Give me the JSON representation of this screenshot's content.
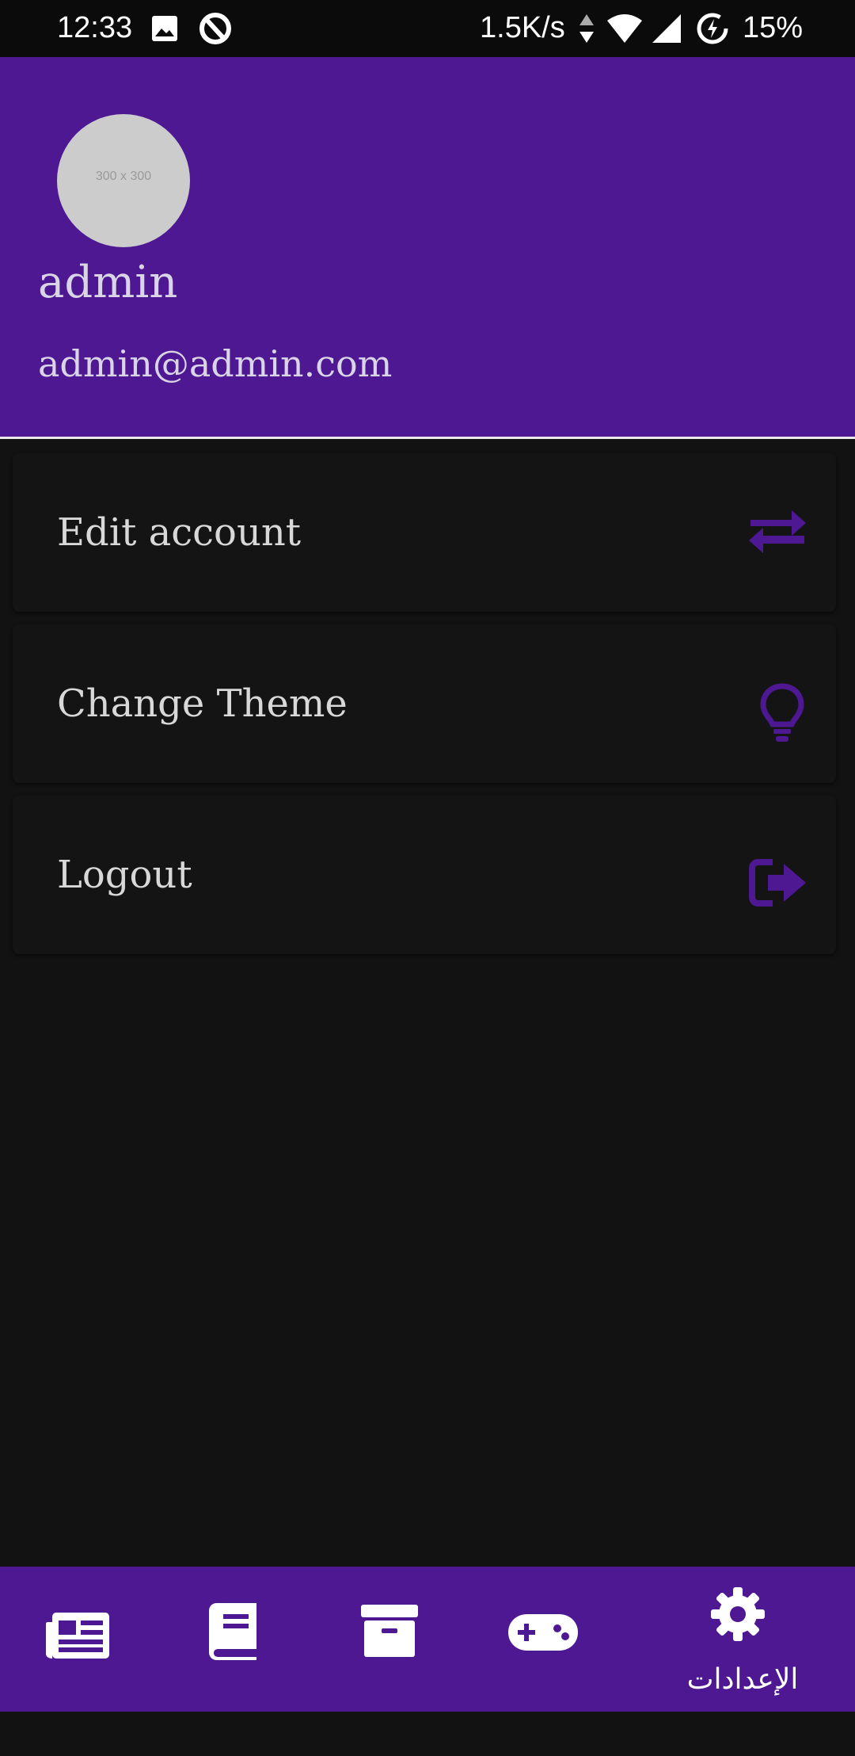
{
  "status_bar": {
    "time": "12:33",
    "network_speed": "1.5K/s",
    "battery": "15%",
    "icons": [
      "image-icon",
      "vpn-q-icon",
      "data-arrows-icon",
      "wifi-icon",
      "cell-signal-icon",
      "battery-saver-icon"
    ]
  },
  "profile": {
    "avatar_placeholder": "300 x 300",
    "name": "admin",
    "email": "admin@admin.com"
  },
  "menu": {
    "items": [
      {
        "label": "Edit account",
        "icon": "swap-arrows-icon"
      },
      {
        "label": "Change Theme",
        "icon": "lightbulb-icon"
      },
      {
        "label": "Logout",
        "icon": "logout-icon"
      }
    ]
  },
  "bottom_nav": {
    "items": [
      {
        "icon": "newspaper-icon"
      },
      {
        "icon": "book-icon"
      },
      {
        "icon": "archive-icon"
      },
      {
        "icon": "gamepad-icon"
      },
      {
        "icon": "gear-icon",
        "label": "الإعدادات",
        "active": true
      }
    ]
  },
  "colors": {
    "accent": "#4e1893",
    "background": "#121212",
    "menu_icon": "#4e1893"
  }
}
